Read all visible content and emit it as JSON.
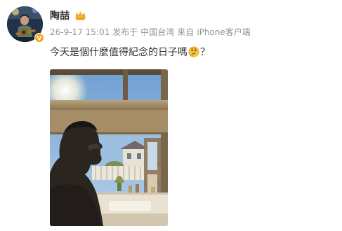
{
  "post": {
    "username": "陶喆",
    "timestamp": "26-9-17 15:01",
    "published_from": "发布于",
    "location": "中国台湾",
    "source_prefix": "来自",
    "source": "iPhone客户端",
    "text": "今天是個什麼值得紀念的日子嗎",
    "text_suffix": "？",
    "emoji": "thinking-emoji",
    "badge": "crown-icon",
    "verified": "verified-badge",
    "colors": {
      "accent": "#f4a61b",
      "meta_text": "#939393",
      "body_text": "#333333"
    }
  }
}
